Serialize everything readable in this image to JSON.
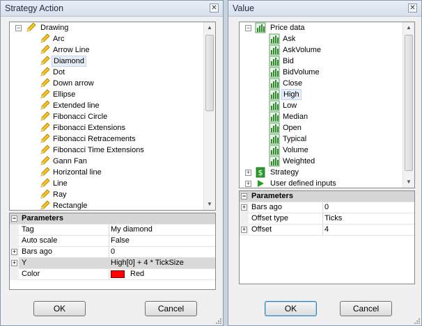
{
  "left_dialog": {
    "title": "Strategy Action",
    "close_glyph": "✕",
    "tree": {
      "root_label": "Drawing",
      "root_expanded_glyph": "⊟",
      "items": [
        "Arc",
        "Arrow Line",
        "Diamond",
        "Dot",
        "Down arrow",
        "Ellipse",
        "Extended line",
        "Fibonacci Circle",
        "Fibonacci Extensions",
        "Fibonacci Retracements",
        "Fibonacci Time Extensions",
        "Gann Fan",
        "Horizontal line",
        "Line",
        "Ray",
        "Rectangle"
      ],
      "selected_item": "Diamond",
      "item_icon": "pencil-icon"
    },
    "grid": {
      "category": "Parameters",
      "rows": [
        {
          "key": "Tag",
          "value": "My diamond",
          "expandable": false
        },
        {
          "key": "Auto scale",
          "value": "False",
          "expandable": false
        },
        {
          "key": "Bars ago",
          "value": "0",
          "expandable": true
        },
        {
          "key": "Y",
          "value": "High[0] + 4 * TickSize",
          "expandable": true,
          "highlighted": true
        },
        {
          "key": "Color",
          "value": "Red",
          "expandable": false,
          "swatch": "#ff0000"
        }
      ]
    },
    "ok_label": "OK",
    "cancel_label": "Cancel"
  },
  "right_dialog": {
    "title": "Value",
    "close_glyph": "✕",
    "tree": {
      "root_label": "Price data",
      "items": [
        "Ask",
        "AskVolume",
        "Bid",
        "BidVolume",
        "Close",
        "High",
        "Low",
        "Median",
        "Open",
        "Typical",
        "Volume",
        "Weighted"
      ],
      "selected_item": "High",
      "item_icon": "chart-icon",
      "collapsed_nodes": [
        {
          "label": "Strategy",
          "icon": "strategy-icon"
        },
        {
          "label": "User defined inputs",
          "icon": "play-icon"
        }
      ]
    },
    "grid": {
      "category": "Parameters",
      "rows": [
        {
          "key": "Bars ago",
          "value": "0",
          "expandable": true
        },
        {
          "key": "Offset type",
          "value": "Ticks",
          "expandable": false
        },
        {
          "key": "Offset",
          "value": "4",
          "expandable": true
        }
      ]
    },
    "ok_label": "OK",
    "cancel_label": "Cancel"
  },
  "colors": {
    "accent": "#3c7fb1",
    "selection": "#e8eef8",
    "category_bg": "#d6d6d6",
    "swatch_red": "#ff0000"
  }
}
